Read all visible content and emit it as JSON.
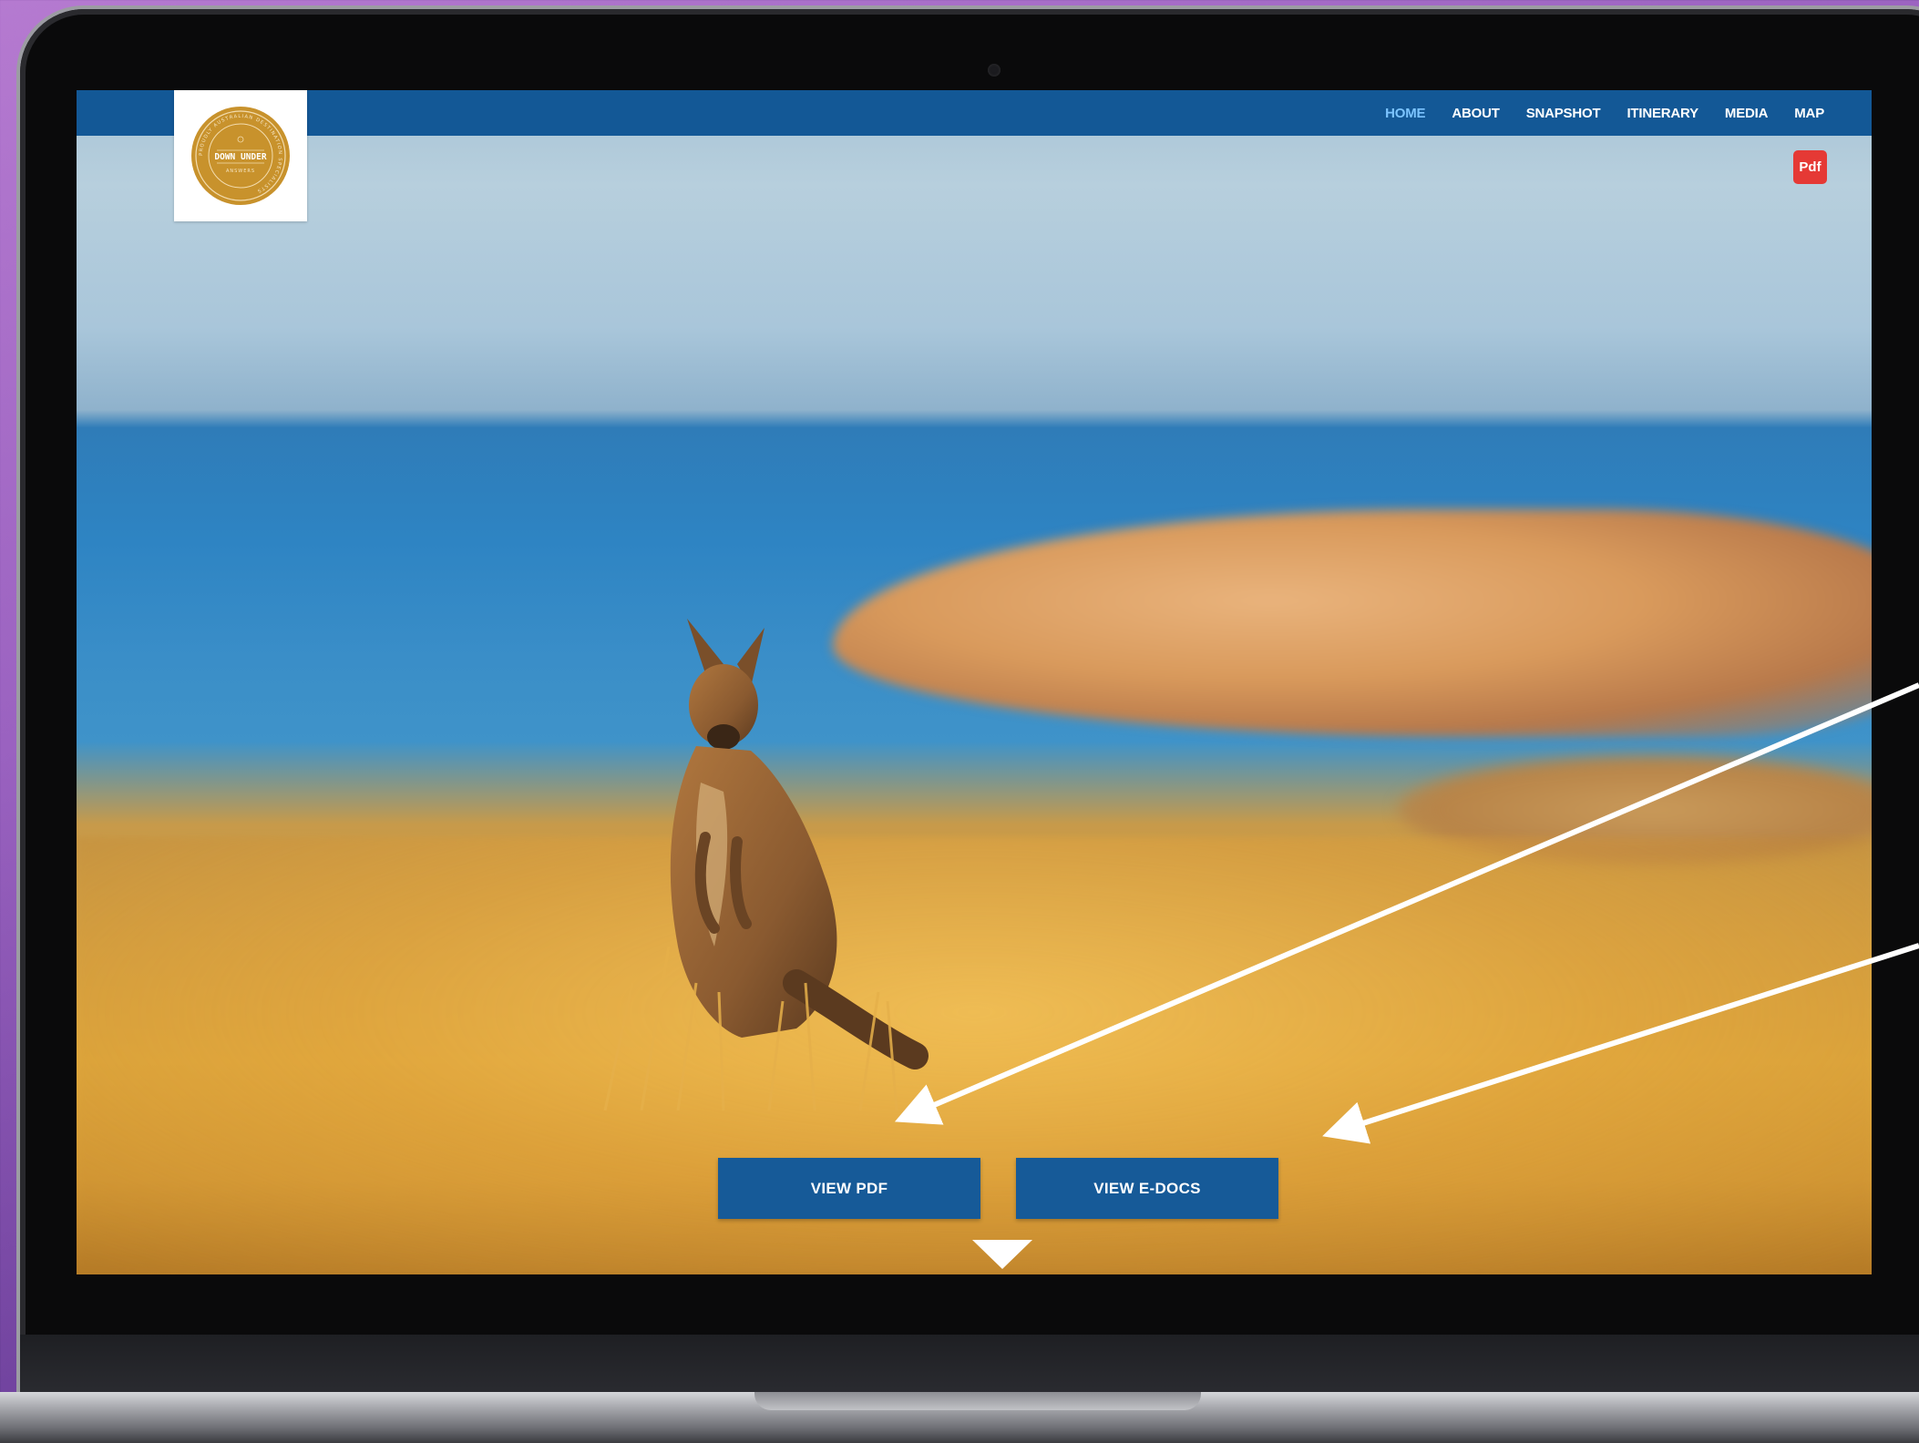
{
  "nav": {
    "items": [
      {
        "label": "HOME",
        "active": true
      },
      {
        "label": "ABOUT",
        "active": false
      },
      {
        "label": "SNAPSHOT",
        "active": false
      },
      {
        "label": "ITINERARY",
        "active": false
      },
      {
        "label": "MEDIA",
        "active": false
      },
      {
        "label": "MAP",
        "active": false
      }
    ],
    "bar_color": "#135896",
    "active_color": "#7cc4ff"
  },
  "logo": {
    "line1": "DOWN UNDER",
    "line2": "ANSWERS",
    "ring_text": "PROUDLY AUSTRALIAN DESTINATION SPECIALISTS",
    "color": "#c8922c"
  },
  "pdf_badge": {
    "label": "Pdf",
    "color": "#e53935"
  },
  "hero": {
    "buttons": {
      "view_pdf": "VIEW PDF",
      "view_edocs": "VIEW E-DOCS"
    },
    "button_color": "#165a98",
    "scroll_icon": "triangle-down-icon"
  },
  "annotations": {
    "arrow_color": "#ffffff",
    "count": 2
  }
}
